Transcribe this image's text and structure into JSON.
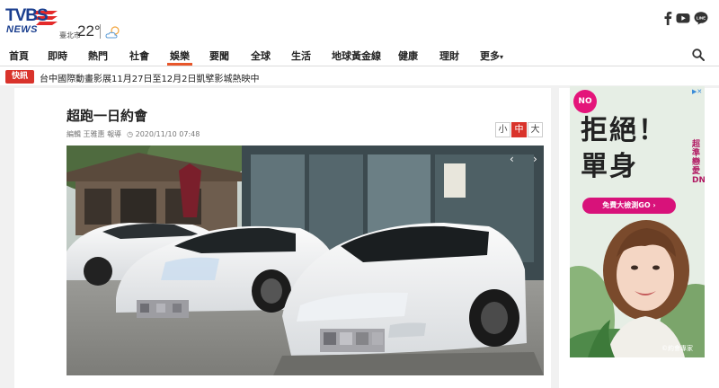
{
  "header": {
    "logo_text": "TVBS",
    "logo_sub": "NEWS",
    "weather_city": "臺北市",
    "weather_temp": "22°",
    "weather_icon": "partly-cloudy-icon",
    "social_icons": [
      "facebook-icon",
      "youtube-icon",
      "line-icon"
    ]
  },
  "nav": {
    "items": [
      "首頁",
      "即時",
      "熱門",
      "社會",
      "娛樂",
      "要聞",
      "全球",
      "生活",
      "地球黃金線",
      "健康",
      "理財",
      "更多"
    ],
    "more_suffix": "▾",
    "active": "娛樂",
    "accent_color": "#e8562a"
  },
  "ticker": {
    "badge": "快訊",
    "text": "台中國際動畫影展11月27日至12月2日凱擘影城熱映中"
  },
  "article": {
    "title": "超跑一日約會",
    "author": "編輯 王雅惠 報導",
    "time": "2020/11/10 07:48",
    "font_sizes": [
      "小",
      "中",
      "大"
    ],
    "selected_font_size": "中",
    "prev_arrow": "‹",
    "next_arrow": "›"
  },
  "ad": {
    "badge": "NO",
    "close": "▶✕",
    "headline_1": "拒絕！",
    "headline_2": "單身",
    "vertical_text": "超準戀愛DNA",
    "button": "免費大檢測GO ›",
    "credit": "©約會專家"
  }
}
